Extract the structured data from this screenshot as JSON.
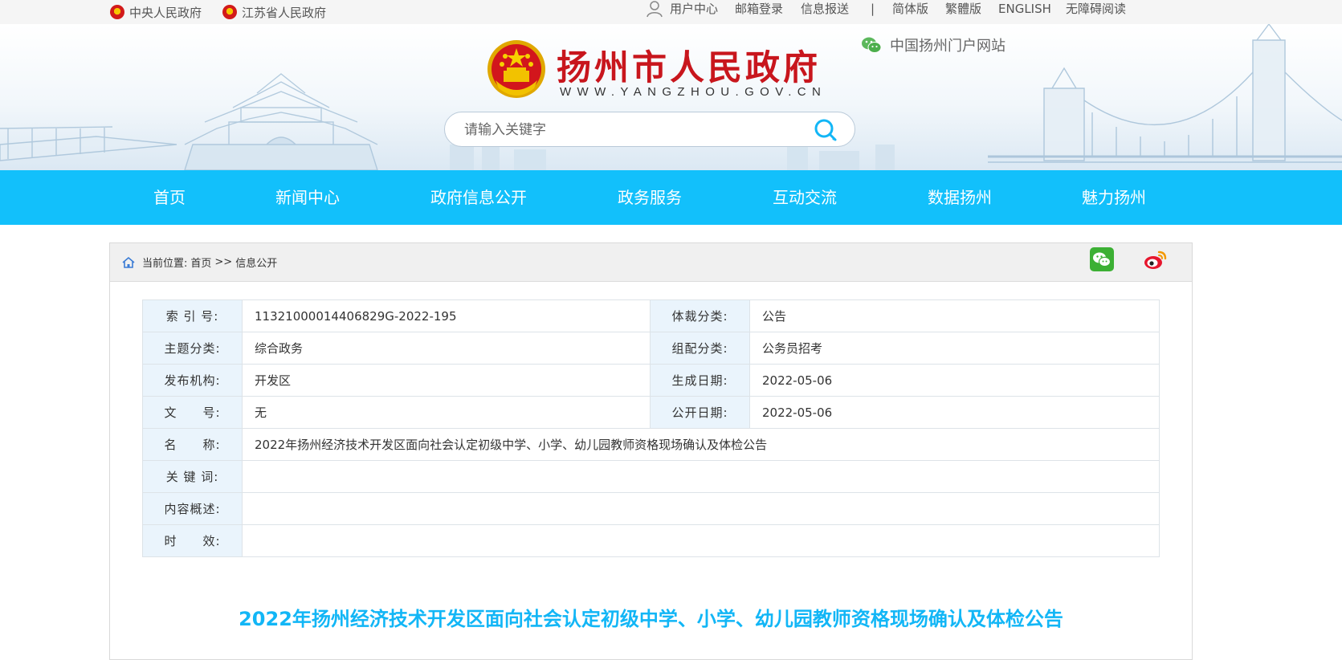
{
  "topbar": {
    "left_links": [
      {
        "label": "中央人民政府",
        "icon": "national-emblem-icon"
      },
      {
        "label": "江苏省人民政府",
        "icon": "national-emblem-icon"
      }
    ],
    "right_links": [
      "用户中心",
      "邮箱登录",
      "信息报送",
      "|",
      "简体版",
      "繁體版",
      "ENGLISH",
      "无障碍阅读"
    ]
  },
  "header": {
    "title": "扬州市人民政府",
    "url": "WWW.YANGZHOU.GOV.CN",
    "portal_label": "中国扬州门户网站",
    "search_placeholder": "请输入关键字"
  },
  "nav": {
    "items": [
      "首页",
      "新闻中心",
      "政府信息公开",
      "政务服务",
      "互动交流",
      "数据扬州",
      "魅力扬州"
    ]
  },
  "breadcrumb": {
    "prefix": "当前位置:",
    "path": [
      "首页",
      ">>",
      "信息公开"
    ]
  },
  "meta": {
    "index_label": "索 引 号:",
    "index_value": "11321000014406829G-2022-195",
    "genre_label": "体裁分类:",
    "genre_value": "公告",
    "topic_label": "主题分类:",
    "topic_value": "综合政务",
    "assign_label": "组配分类:",
    "assign_value": "公务员招考",
    "publisher_label": "发布机构:",
    "publisher_value": "开发区",
    "created_label": "生成日期:",
    "created_value": "2022-05-06",
    "docno_label": "文　　号:",
    "docno_value": "无",
    "public_label": "公开日期:",
    "public_value": "2022-05-06",
    "name_label": "名　　称:",
    "name_value": "2022年扬州经济技术开发区面向社会认定初级中学、小学、幼儿园教师资格现场确认及体检公告",
    "keywords_label": "关 键 词:",
    "keywords_value": "",
    "summary_label": "内容概述:",
    "summary_value": "",
    "validity_label": "时　　效:",
    "validity_value": ""
  },
  "article": {
    "title": "2022年扬州经济技术开发区面向社会认定初级中学、小学、幼儿园教师资格现场确认及体检公告"
  },
  "colors": {
    "nav_bg": "#12c0fb",
    "title_red": "#c8161d",
    "article_title": "#12b6f6",
    "label_bg": "#eaf4fc"
  }
}
